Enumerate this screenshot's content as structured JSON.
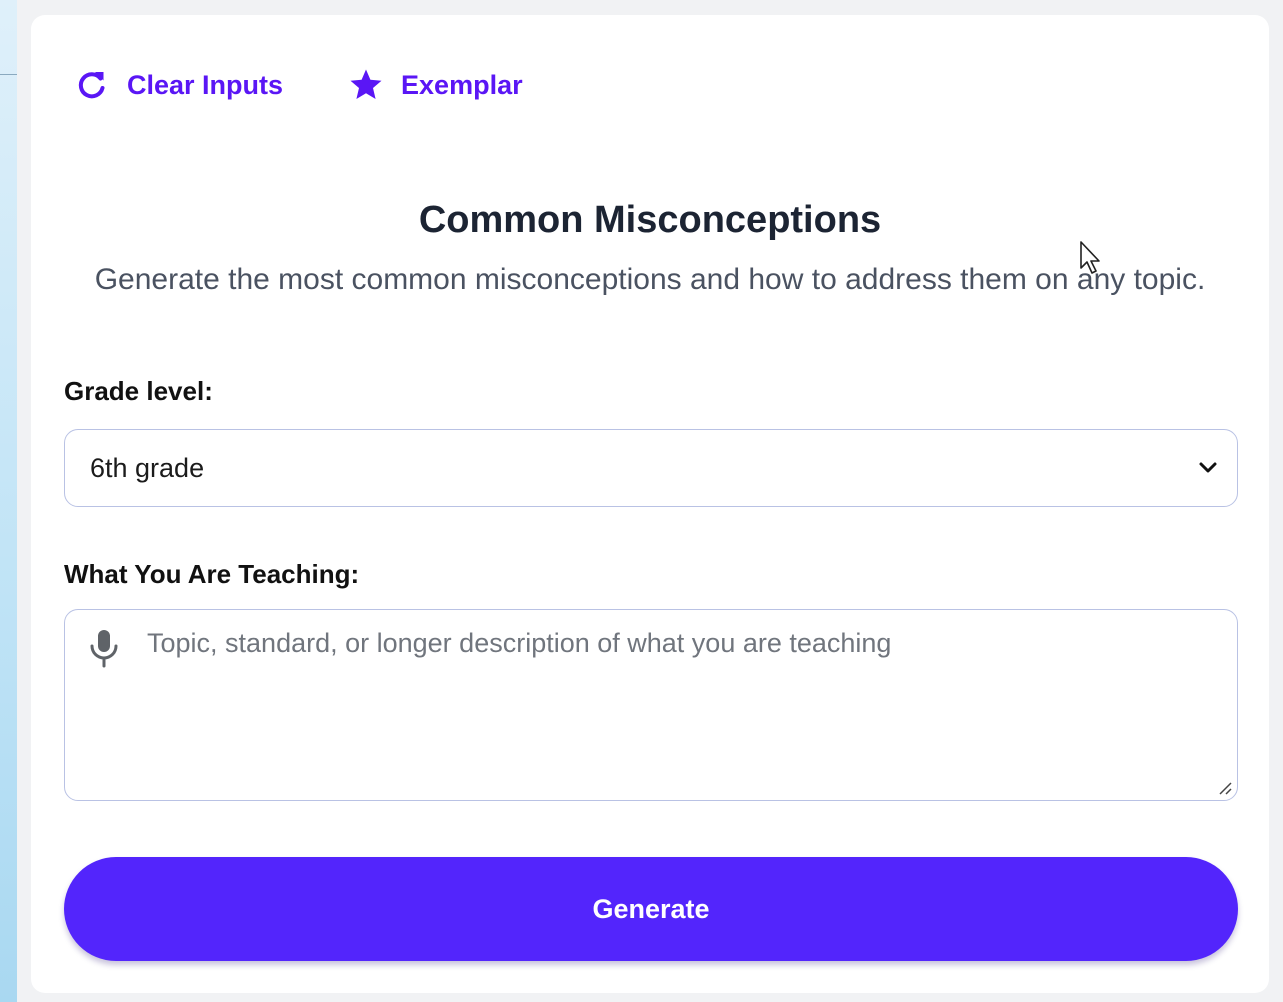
{
  "toolbar": {
    "clear_label": "Clear Inputs",
    "clear_icon": "refresh-icon",
    "exemplar_label": "Exemplar",
    "exemplar_icon": "star-icon",
    "accent_color": "#5a16f5"
  },
  "header": {
    "title": "Common Misconceptions",
    "subtitle": "Generate the most common misconceptions and how to address them on any topic."
  },
  "form": {
    "grade": {
      "label": "Grade level:",
      "selected": "6th grade"
    },
    "teaching": {
      "label": "What You Are Teaching:",
      "placeholder": "Topic, standard, or longer description of what you are teaching",
      "value": ""
    },
    "generate_label": "Generate",
    "button_color": "#5325fc"
  }
}
